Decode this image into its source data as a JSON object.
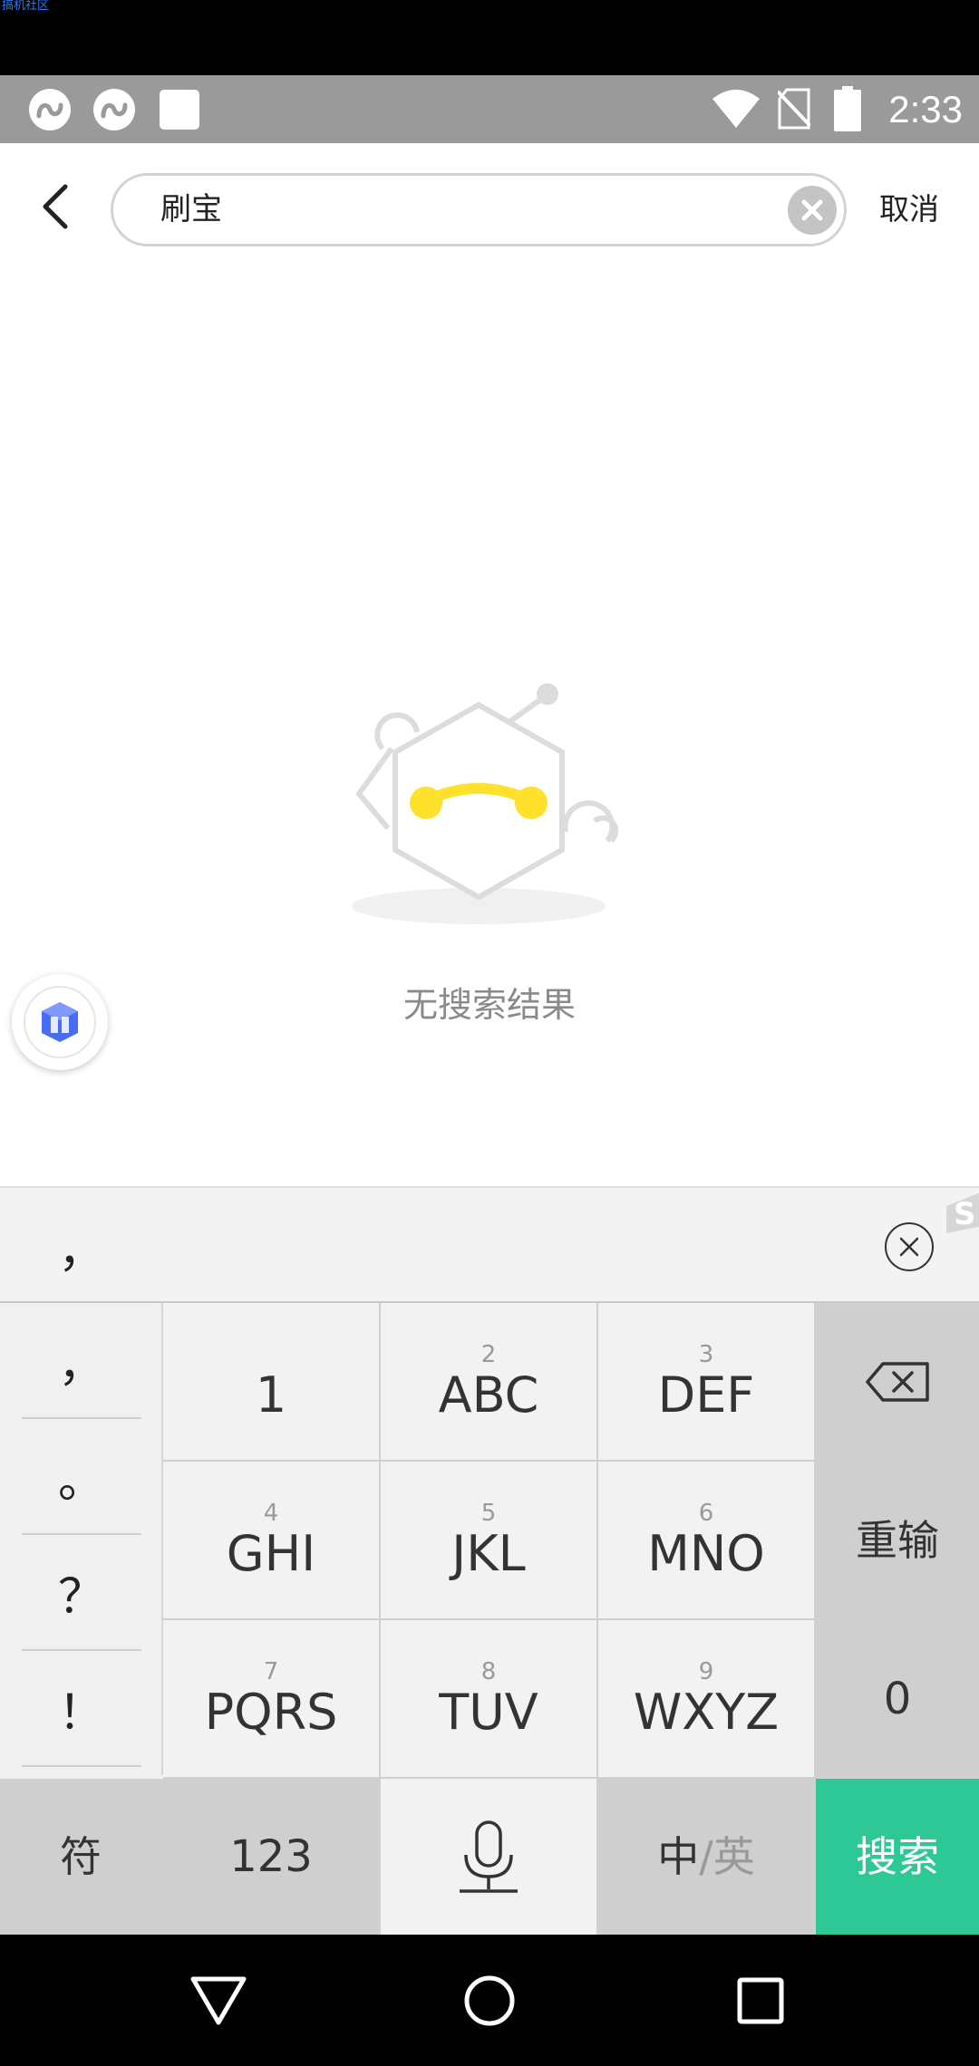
{
  "watermark": "搞机社区",
  "status_bar": {
    "time": "2:33",
    "icons": [
      "app-notification-icon",
      "app-notification-icon",
      "square-notification-icon",
      "wifi-icon",
      "no-sim-icon",
      "battery-icon"
    ]
  },
  "search": {
    "query": "刷宝",
    "cancel_label": "取消"
  },
  "empty_state": {
    "message": "无搜索结果"
  },
  "keyboard": {
    "candidate": "，",
    "punctuation": [
      "，",
      "。",
      "？",
      "！"
    ],
    "rows": [
      [
        {
          "sub": "",
          "main": "1"
        },
        {
          "sub": "2",
          "main": "ABC"
        },
        {
          "sub": "3",
          "main": "DEF"
        }
      ],
      [
        {
          "sub": "4",
          "main": "GHI"
        },
        {
          "sub": "5",
          "main": "JKL"
        },
        {
          "sub": "6",
          "main": "MNO"
        }
      ],
      [
        {
          "sub": "7",
          "main": "PQRS"
        },
        {
          "sub": "8",
          "main": "TUV"
        },
        {
          "sub": "9",
          "main": "WXYZ"
        }
      ]
    ],
    "side_keys": {
      "reinput": "重输",
      "zero": "0"
    },
    "bottom": {
      "symbols": "符",
      "numbers": "123",
      "lang_cn": "中",
      "lang_sep": "/",
      "lang_en": "英",
      "search": "搜索"
    }
  },
  "colors": {
    "accent_green": "#2ec897",
    "face_yellow": "#ffe02a"
  }
}
